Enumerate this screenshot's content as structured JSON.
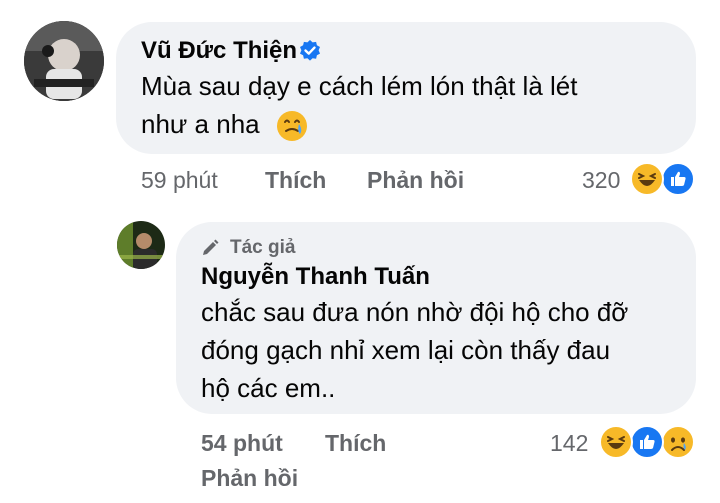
{
  "comment1": {
    "author": "Vũ Đức Thiện",
    "verified": true,
    "text_line1": "Mùa sau dạy e cách lém lón thật là lét",
    "text_line2": "như a nha",
    "emoji": "crying-smile",
    "time": "59 phút",
    "like": "Thích",
    "reply": "Phản hồi",
    "reaction_count": "320",
    "reactions": [
      "haha",
      "like"
    ]
  },
  "comment2": {
    "badge": "Tác giả",
    "author": "Nguyễn Thanh Tuấn",
    "text_line1": "chắc sau đưa nón nhờ đội hộ cho đỡ",
    "text_line2": "đóng gạch nhỉ xem lại còn thấy đau",
    "text_line3": "hộ các em..",
    "time": "54 phút",
    "like": "Thích",
    "reply": "Phản hồi",
    "reaction_count": "142",
    "reactions": [
      "haha",
      "like",
      "sad"
    ]
  },
  "colors": {
    "bubble": "#f0f2f5",
    "meta": "#65676b",
    "like_blue": "#1877f2",
    "haha_yellow": "#f7b928"
  }
}
